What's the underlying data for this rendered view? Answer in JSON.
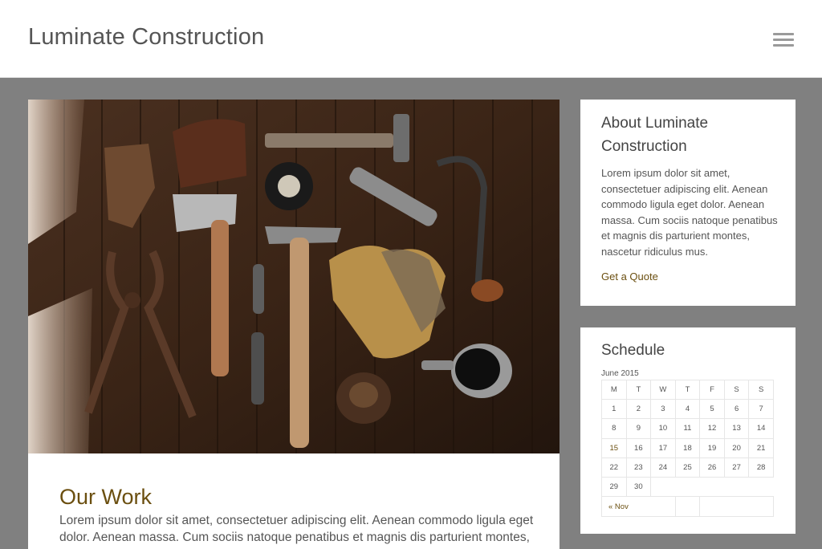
{
  "header": {
    "site_title": "Luminate Construction",
    "menu_icon": "hamburger-menu-icon"
  },
  "main": {
    "hero_image": "tools-on-wooden-table-photo",
    "post_title": "Our Work",
    "post_excerpt": "Lorem ipsum dolor sit amet, consectetuer adipiscing elit. Aenean commodo ligula eget dolor. Aenean massa. Cum sociis natoque penatibus et magnis dis parturient montes,"
  },
  "about_widget": {
    "title": "About Luminate Construction",
    "text": "Lorem ipsum dolor sit amet, consectetuer adipiscing elit. Aenean commodo ligula eget dolor. Aenean massa. Cum sociis natoque penatibus et magnis dis parturient montes, nascetur ridiculus mus.",
    "link_label": "Get a Quote"
  },
  "schedule_widget": {
    "title": "Schedule",
    "caption": "June 2015",
    "weekdays": [
      "M",
      "T",
      "W",
      "T",
      "F",
      "S",
      "S"
    ],
    "weeks": [
      [
        "1",
        "2",
        "3",
        "4",
        "5",
        "6",
        "7"
      ],
      [
        "8",
        "9",
        "10",
        "11",
        "12",
        "13",
        "14"
      ],
      [
        "15",
        "16",
        "17",
        "18",
        "19",
        "20",
        "21"
      ],
      [
        "22",
        "23",
        "24",
        "25",
        "26",
        "27",
        "28"
      ],
      [
        "29",
        "30"
      ]
    ],
    "today": "15",
    "prev_label": "« Nov"
  },
  "colors": {
    "accent": "#6b4f10",
    "page_bg": "#808080"
  }
}
